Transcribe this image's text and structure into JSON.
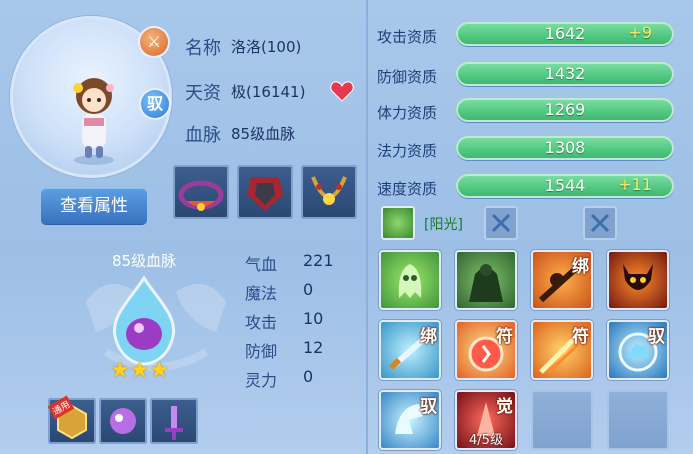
{
  "profile": {
    "name_label": "名称",
    "name_value": "洛洛(100)",
    "aptitude_label": "天资",
    "aptitude_value": "极(16141)",
    "bloodline_label": "血脉",
    "bloodline_value": "85级血脉",
    "fight_badge_glyph": "⚔",
    "ride_badge": "驭",
    "view_attributes_button": "查看属性"
  },
  "stats": [
    {
      "label": "攻击资质",
      "value": "1642",
      "bonus": "+9"
    },
    {
      "label": "防御资质",
      "value": "1432",
      "bonus": ""
    },
    {
      "label": "体力资质",
      "value": "1269",
      "bonus": ""
    },
    {
      "label": "法力资质",
      "value": "1308",
      "bonus": ""
    },
    {
      "label": "速度资质",
      "value": "1544",
      "bonus": "+11"
    }
  ],
  "passive": {
    "label": "[阳光]"
  },
  "bloodline_panel": {
    "title": "85级血脉",
    "stars": 3,
    "slot_tag": "通用"
  },
  "attributes": [
    {
      "label": "气血",
      "value": "221"
    },
    {
      "label": "魔法",
      "value": "0"
    },
    {
      "label": "攻击",
      "value": "10"
    },
    {
      "label": "防御",
      "value": "12"
    },
    {
      "label": "灵力",
      "value": "0"
    }
  ],
  "skills": [
    {
      "icon": "ghost-skill-icon",
      "tag": ""
    },
    {
      "icon": "giant-skill-icon",
      "tag": ""
    },
    {
      "icon": "bind-strike-skill-icon",
      "tag": "绑"
    },
    {
      "icon": "demon-skill-icon",
      "tag": ""
    },
    {
      "icon": "sword-bind-skill-icon",
      "tag": "绑"
    },
    {
      "icon": "talisman-orb-skill-icon",
      "tag": "符"
    },
    {
      "icon": "talisman-blade-skill-icon",
      "tag": "符"
    },
    {
      "icon": "beast-ride-skill-icon",
      "tag": "驭"
    },
    {
      "icon": "claw-ride-skill-icon",
      "tag": "驭"
    },
    {
      "icon": "awaken-skill-icon",
      "tag": "觉",
      "caption": "4/5级"
    }
  ],
  "colors": {
    "bar_green": "#4fc77f",
    "bonus_yellow": "#ffe66b",
    "button_blue": "#3772c0",
    "heart_red": "#e5394f"
  }
}
